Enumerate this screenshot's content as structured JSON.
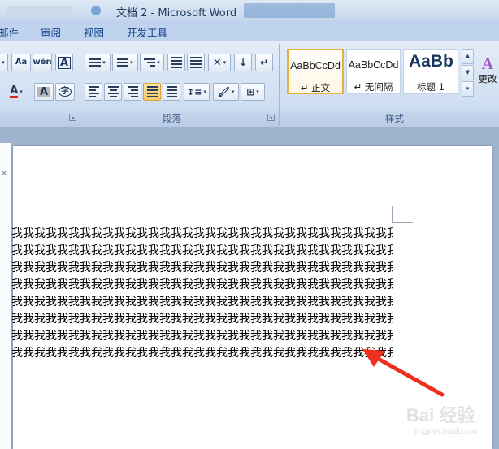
{
  "window": {
    "title": "文档 2 - Microsoft Word"
  },
  "tabs": [
    {
      "label": "邮件"
    },
    {
      "label": "审阅"
    },
    {
      "label": "视图"
    },
    {
      "label": "开发工具"
    }
  ],
  "ribbon": {
    "groups": {
      "paragraph": "段落",
      "styles": "样式"
    },
    "styles": [
      {
        "sample": "AaBbCcDd",
        "name": "↵ 正文",
        "selected": true
      },
      {
        "sample": "AaBbCcDd",
        "name": "↵ 无间隔",
        "selected": false
      },
      {
        "sample": "AaBb",
        "name": "标题 1",
        "selected": false
      }
    ],
    "change_styles_label": "更改"
  },
  "document": {
    "lines": [
      "我我我我我我我我我我我我我我我我我我我我我我我我我我我我我我我我我我",
      "我我我我我我我我我我我我我我我我我我我我我我我我我我我我我我我我我我",
      "我我我我我我我我我我我我我我我我我我我我我我我我我我我我我我我我我我",
      "我我我我我我我我我我我我我我我我我我我我我我我我我我我我我我我我我我",
      "我我我我我我我我我我我我我我我我我我我我我我我我我我我我我我我我我我",
      "我我我我我我我我我我我我我我我我我我我我我我我我我我我我我我我我我我",
      "我我我我我我我我我我我我我我我我我我我我我我我我我我我我我我我我我我",
      "我我我我我我我我我我我我我我我我我我我我我我我我我我我我我我我我我我"
    ]
  },
  "colors": {
    "accent": "#15428b",
    "annotation_arrow": "#f0301e"
  },
  "watermark": {
    "main": "Bai 经验",
    "sub": "jingyan.baidu.com"
  }
}
